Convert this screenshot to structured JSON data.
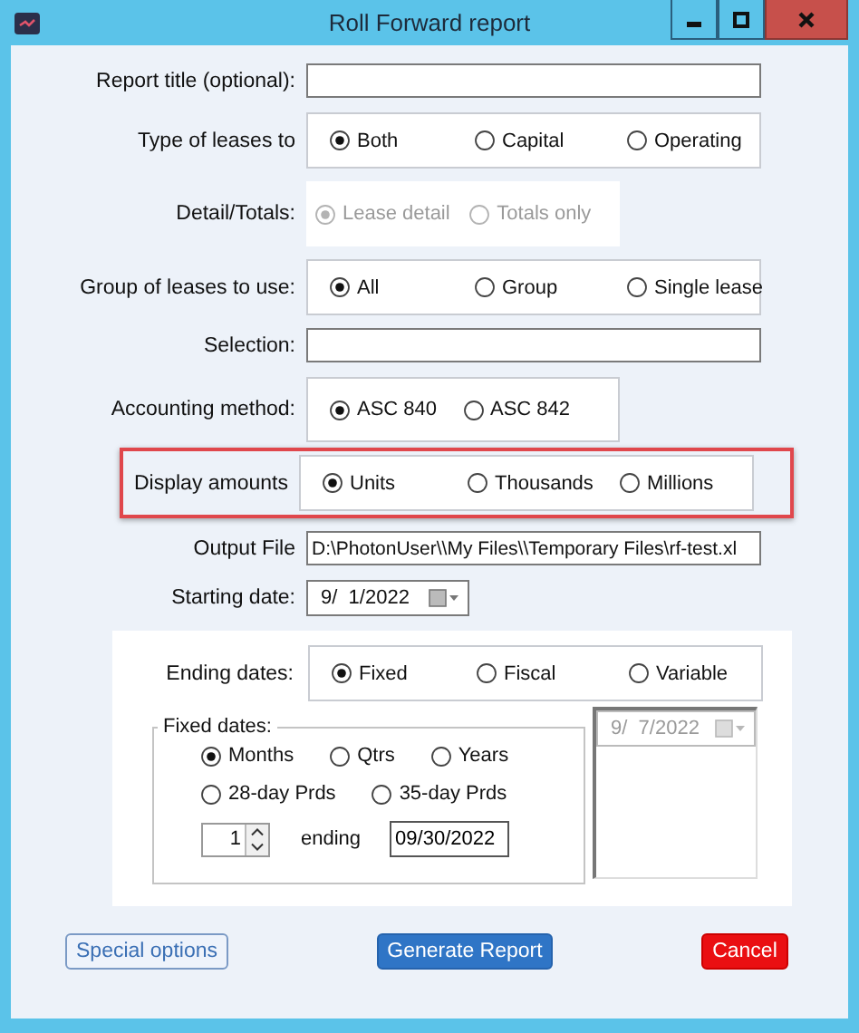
{
  "window": {
    "title": "Roll Forward report"
  },
  "form": [
    {
      "kind": "text",
      "label": "Report title (optional):"
    },
    {
      "kind": "radios",
      "label": "Type of leases to",
      "disabled": false,
      "highlighted": false,
      "options": [
        {
          "label": "Both",
          "selected": true
        },
        {
          "label": "Capital",
          "selected": false
        },
        {
          "label": "Operating",
          "selected": false
        }
      ]
    },
    {
      "kind": "radios",
      "label": "Detail/Totals:",
      "disabled": true,
      "highlighted": false,
      "options": [
        {
          "label": "Lease detail",
          "selected": true
        },
        {
          "label": "Totals only",
          "selected": false
        }
      ]
    },
    {
      "kind": "radios",
      "label": "Group of leases to use:",
      "disabled": false,
      "highlighted": false,
      "options": [
        {
          "label": "All",
          "selected": true
        },
        {
          "label": "Group",
          "selected": false
        },
        {
          "label": "Single lease",
          "selected": false
        }
      ]
    },
    {
      "kind": "text",
      "label": "Selection:"
    },
    {
      "kind": "radios",
      "label": "Accounting method:",
      "disabled": false,
      "highlighted": false,
      "options": [
        {
          "label": "ASC 840",
          "selected": true
        },
        {
          "label": "ASC 842",
          "selected": false
        }
      ]
    },
    {
      "kind": "radios",
      "label": "Display amounts",
      "disabled": false,
      "highlighted": true,
      "options": [
        {
          "label": "Units",
          "selected": true
        },
        {
          "label": "Thousands",
          "selected": false
        },
        {
          "label": "Millions",
          "selected": false
        }
      ]
    },
    {
      "kind": "text",
      "label": "Output File",
      "value": "D:\\PhotonUser\\\\My Files\\\\Temporary Files\\rf-test.xl"
    },
    {
      "kind": "date",
      "label": "Starting date:",
      "value": "9/  1/2022"
    }
  ],
  "ending": {
    "label": "Ending dates:",
    "options": [
      {
        "label": "Fixed",
        "selected": true
      },
      {
        "label": "Fiscal",
        "selected": false
      },
      {
        "label": "Variable",
        "selected": false
      }
    ],
    "fixed_dates": {
      "legend": "Fixed dates:",
      "period_rows": [
        {
          "options": [
            {
              "label": "Months",
              "selected": true
            },
            {
              "label": "Qtrs",
              "selected": false
            },
            {
              "label": "Years",
              "selected": false
            }
          ]
        },
        {
          "options": [
            {
              "label": "28-day Prds",
              "selected": false
            },
            {
              "label": "35-day Prds",
              "selected": false
            }
          ]
        }
      ],
      "count": "1",
      "ending_label": "ending",
      "ending_value": "09/30/2022"
    },
    "date_list": {
      "value": "9/  7/2022",
      "disabled": true
    }
  },
  "buttons": [
    {
      "label": "Special options",
      "kind": "outline"
    },
    {
      "label": "Generate Report",
      "kind": "primary"
    },
    {
      "label": "Cancel",
      "kind": "danger"
    }
  ]
}
